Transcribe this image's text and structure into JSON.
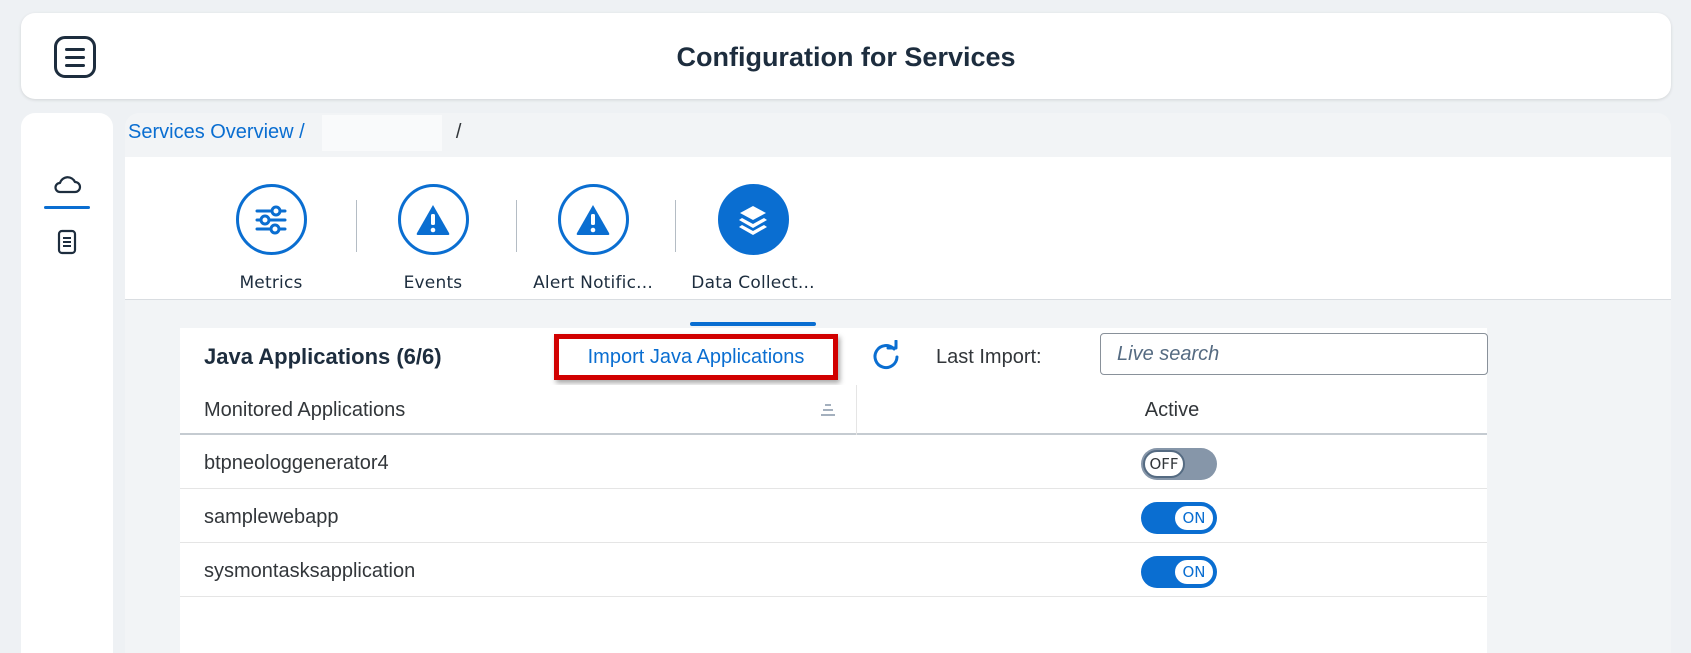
{
  "header": {
    "title": "Configuration for Services"
  },
  "sidebar": {
    "items": [
      {
        "icon": "cloud-icon"
      },
      {
        "icon": "document-icon"
      }
    ]
  },
  "breadcrumb": {
    "link": "Services Overview /",
    "separator": "/"
  },
  "tabs": [
    {
      "label": "Metrics",
      "icon": "sliders-icon",
      "selected": false
    },
    {
      "label": "Events",
      "icon": "warning-icon",
      "selected": false
    },
    {
      "label": "Alert Notific...",
      "icon": "warning-icon",
      "selected": false
    },
    {
      "label": "Data Collect...",
      "icon": "layers-icon",
      "selected": true
    }
  ],
  "panel": {
    "title": "Java Applications (6/6)",
    "import_label": "Import Java Applications",
    "last_import_label": "Last Import:",
    "search_placeholder": "Live search"
  },
  "table": {
    "columns": [
      "Monitored Applications",
      "Active"
    ],
    "rows": [
      {
        "name": "btpneologgenerator4",
        "active": false,
        "toggle_label": "OFF"
      },
      {
        "name": "samplewebapp",
        "active": true,
        "toggle_label": "ON"
      },
      {
        "name": "sysmontasksapplication",
        "active": true,
        "toggle_label": "ON"
      }
    ]
  },
  "colors": {
    "accent": "#0a6ed1",
    "highlight_border": "#d10000",
    "toggle_off": "#8696a9"
  }
}
